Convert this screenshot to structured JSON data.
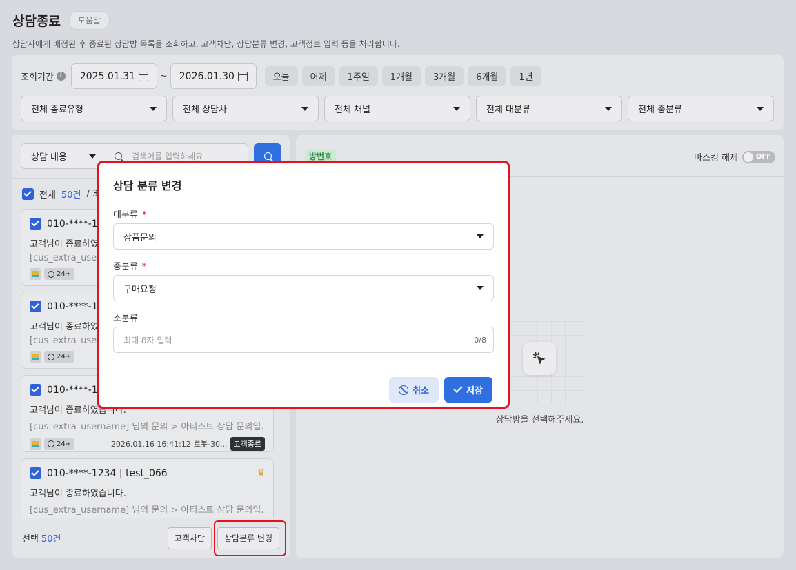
{
  "header": {
    "title": "상담종료",
    "help_label": "도움말",
    "subtitle": "상담사에게 배정된 후 종료된 상담방 목록을 조회하고, 고객차단, 상담분류 변경, 고객정보 입력 등을 처리합니다."
  },
  "filters": {
    "period_label": "조회기간",
    "date_from": "2025.01.31",
    "date_sep": "~",
    "date_to": "2026.01.30",
    "quick_ranges": [
      "오늘",
      "어제",
      "1주일",
      "1개월",
      "3개월",
      "6개월",
      "1년"
    ],
    "selects": [
      "전체 종료유형",
      "전체 상담사",
      "전체 채널",
      "전체 대분류",
      "전체 중분류"
    ]
  },
  "list": {
    "search_type": "상담 내용",
    "search_placeholder": "검색어를 입력하세요",
    "select_all_label": "전체",
    "total_count": "50건",
    "count_sep": "/ 3",
    "cards": [
      {
        "phone": "010-****-1",
        "message": "고객님이 종료하였",
        "sub": "[cus_extra_userna",
        "time_badge": "24+"
      },
      {
        "phone": "010-****-1",
        "message": "고객님이 종료하였",
        "sub": "[cus_extra_userna",
        "time_badge": "24+"
      },
      {
        "phone": "010-****-1",
        "message": "고객님이 종료하였습니다.",
        "sub": "[cus_extra_username] 님의 문의 > 아티스트 상담 문의입...",
        "time_badge": "24+",
        "date": "2026.01.16 16:41:12",
        "agent": "로봇-30...",
        "end_badge": "고객종료"
      },
      {
        "phone": "010-****-1234 | test_066",
        "message": "고객님이 종료하였습니다.",
        "sub": "[cus_extra_username] 님의 문의 > 아티스트 상담 문의입...",
        "crown": "♛"
      }
    ],
    "footer": {
      "selected_label": "선택",
      "selected_count": "50건",
      "block_button": "고객차단",
      "change_category_button": "상담분류 변경"
    }
  },
  "detail": {
    "room_label": "방번호",
    "masking_label": "마스킹 해제",
    "toggle_label": "OFF",
    "empty_text": "상담방을 선택해주세요."
  },
  "modal": {
    "title": "상담 분류 변경",
    "major_label": "대분류",
    "major_value": "상품문의",
    "middle_label": "중분류",
    "middle_value": "구매요청",
    "minor_label": "소분류",
    "minor_placeholder": "최대 8자 입력",
    "minor_counter": "0/8",
    "required_mark": "*",
    "cancel_button": "취소",
    "save_button": "저장"
  },
  "colors": {
    "accent": "#2f6fe0",
    "highlight": "#e3141f",
    "room_badge": "#cbe9d3"
  }
}
